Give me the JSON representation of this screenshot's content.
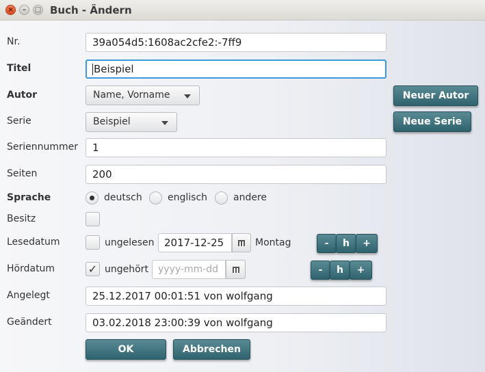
{
  "window": {
    "title": "Buch - Ändern",
    "close_glyph": "×",
    "min_glyph": "–",
    "max_glyph": "□"
  },
  "form": {
    "nr": {
      "label": "Nr.",
      "value": "39a054d5:1608ac2cfe2:-7ff9"
    },
    "titel": {
      "label": "Titel",
      "value": "Beispiel"
    },
    "autor": {
      "label": "Autor",
      "selected": "Name, Vorname",
      "new_button": "Neuer Autor"
    },
    "serie": {
      "label": "Serie",
      "selected": "Beispiel",
      "new_button": "Neue Serie"
    },
    "seriennummer": {
      "label": "Seriennummer",
      "value": "1"
    },
    "seiten": {
      "label": "Seiten",
      "value": "200"
    },
    "sprache": {
      "label": "Sprache",
      "options": [
        {
          "label": "deutsch",
          "checked": true
        },
        {
          "label": "englisch",
          "checked": false
        },
        {
          "label": "andere",
          "checked": false
        }
      ]
    },
    "besitz": {
      "label": "Besitz",
      "checked": false
    },
    "lesedatum": {
      "label": "Lesedatum",
      "check_label": "ungelesen",
      "checked": false,
      "date": "2017-12-25",
      "weekday": "Montag",
      "steps": [
        "-",
        "h",
        "+"
      ]
    },
    "hoerdatum": {
      "label": "Hördatum",
      "check_label": "ungehört",
      "checked": true,
      "checkmark": "✓",
      "placeholder": "yyyy-mm-dd",
      "steps": [
        "-",
        "h",
        "+"
      ]
    },
    "angelegt": {
      "label": "Angelegt",
      "value": "25.12.2017 00:01:51 von wolfgang"
    },
    "geaendert": {
      "label": "Geändert",
      "value": "03.02.2018 23:00:39 von wolfgang"
    }
  },
  "buttons": {
    "ok": "OK",
    "cancel": "Abbrechen"
  },
  "colors": {
    "accent": "#2f636e",
    "focus": "#3a9ad9",
    "close": "#e0582c"
  }
}
